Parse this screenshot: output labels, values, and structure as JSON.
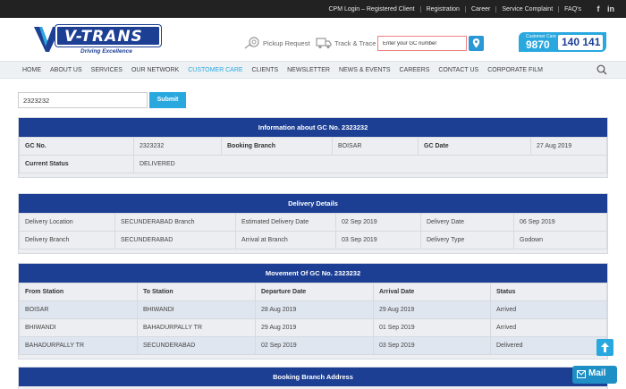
{
  "topbar": {
    "links": [
      "CPM Login – Registered Client",
      "Registration",
      "Career",
      "Service Complaint",
      "FAQ's"
    ],
    "social": [
      "f",
      "in"
    ]
  },
  "brand": {
    "name": "V-TRANS",
    "tagline": "Driving Excellence"
  },
  "header": {
    "pickup_label": "Pickup Request",
    "track_label": "Track & Trace",
    "gc_placeholder": "Enter your GC number",
    "customer_care_label": "Customer Care",
    "phone_part1": "9870",
    "phone_part2": "140 141"
  },
  "nav": {
    "items": [
      "HOME",
      "ABOUT US",
      "SERVICES",
      "OUR NETWORK",
      "CUSTOMER CARE",
      "CLIENTS",
      "NEWSLETTER",
      "NEWS & EVENTS",
      "CAREERS",
      "CONTACT US",
      "CORPORATE FILM"
    ],
    "active_index": 4
  },
  "search": {
    "value": "2323232",
    "submit_label": "Submit"
  },
  "info": {
    "title": "Information about GC No. 2323232",
    "gc_no_label": "GC No.",
    "gc_no_value": "2323232",
    "booking_branch_label": "Booking Branch",
    "booking_branch_value": "BOISAR",
    "gc_date_label": "GC Date",
    "gc_date_value": "27 Aug 2019",
    "status_label": "Current Status",
    "status_value": "DELIVERED"
  },
  "delivery": {
    "title": "Delivery Details",
    "rows": [
      [
        "Delivery Location",
        "SECUNDERABAD Branch",
        "Estimated Delivery Date",
        "02 Sep 2019",
        "Delivery Date",
        "06 Sep 2019"
      ],
      [
        "Delivery Branch",
        "SECUNDERABAD",
        "Arrival at Branch",
        "03 Sep 2019",
        "Delivery Type",
        "Godown"
      ]
    ]
  },
  "movement": {
    "title": "Movement Of GC No. 2323232",
    "columns": [
      "From Station",
      "To Station",
      "Departure Date",
      "Arrival Date",
      "Status"
    ],
    "rows": [
      [
        "BOISAR",
        "BHIWANDI",
        "28 Aug 2019",
        "29 Aug 2019",
        "Arrived"
      ],
      [
        "BHIWANDI",
        "BAHADURPALLY TR",
        "29 Aug 2019",
        "01 Sep 2019",
        "Arrived"
      ],
      [
        "BAHADURPALLY TR",
        "SECUNDERABAD",
        "02 Sep 2019",
        "03 Sep 2019",
        "Delivered"
      ]
    ]
  },
  "booking_address": {
    "title": "Booking Branch Address"
  },
  "mail_label": "Mail",
  "colors": {
    "primary": "#1c3f94",
    "accent": "#29a8df",
    "topbar": "#222222",
    "row_alt": "#e0e6f0"
  }
}
